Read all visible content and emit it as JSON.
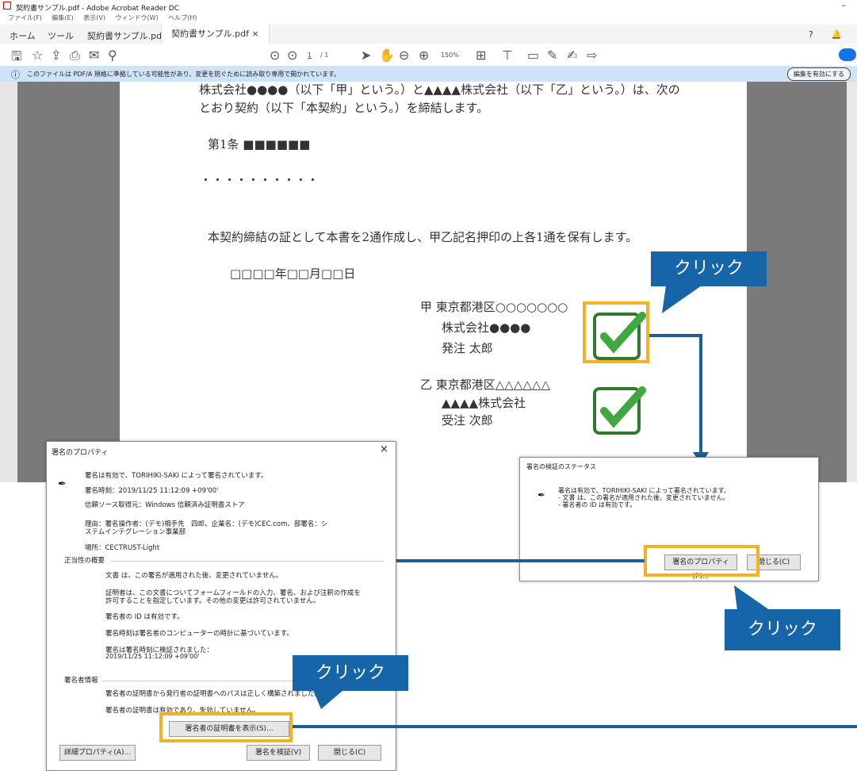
{
  "window": {
    "title": "契約書サンプル.pdf - Adobe Acrobat Reader DC",
    "menu": [
      "ファイル(F)",
      "編集(E)",
      "表示(V)",
      "ウィンドウ(W)",
      "ヘルプ(H)"
    ],
    "tabs": [
      "ホーム",
      "ツール",
      "契約書サンプル.pdf",
      "契約書サンプル.pdf ×"
    ],
    "page_current": "1",
    "page_total": "/ 1",
    "zoom": "150%",
    "info_text": "このファイルは PDF/A 規格に準拠している可能性があり、変更を防ぐために読み取り専用で開かれています。",
    "enable_edit": "編集を有効にする"
  },
  "document": {
    "line1": "株式会社●●●●（以下「甲」という。）と▲▲▲▲株式会社（以下「乙」という。）は、次の",
    "line2": "とおり契約（以下「本契約」という。）を締結します。",
    "article": "第1条 ■■■■■■",
    "dots": "・・・・・・・・・・",
    "closing": "本契約締結の証として本書を2通作成し、甲乙記名押印の上各1通を保有します。",
    "date": "□□□□年□□月□□日",
    "party_a": [
      "甲 東京都港区○○○○○○○",
      "株式会社●●●●",
      "発注 太郎"
    ],
    "party_b": [
      "乙 東京都港区△△△△△△",
      "▲▲▲▲株式会社",
      "受注 次郎"
    ]
  },
  "callouts": {
    "click": "クリック"
  },
  "status_dialog": {
    "title": "署名の検証のステータス",
    "lines": [
      "署名は有効で、TORIHIKI-SAKI によって署名されています。",
      "- 文書 は、この署名が適用された後、変更されていません。",
      "- 署名者の ID は有効です。"
    ],
    "properties_button": "署名のプロパティ(P)...",
    "close_button": "閉じる(C)"
  },
  "properties_dialog": {
    "title": "署名のプロパティ",
    "close_x": "×",
    "signed_by": "署名は有効で、TORIHIKI-SAKI によって署名されています。",
    "signed_time": "署名時刻：2019/11/25 11:12:09 +09'00'",
    "trust_source": "信頼ソース取得元：Windows 信頼済み証明書ストア",
    "reason1": "理由：署名操作者：(デモ)相手先　四郎、企業名：(デモ)CEC.com、部署名：シ",
    "reason2": "ステムインテグレーション事業部",
    "location": "場所：CECTRUST-Light",
    "validity_header": "正当性の概要",
    "validity": [
      "文書 は、この署名が適用された後、変更されていません。",
      "証明者は、この文書についてフォームフィールドの入力、署名、および注釈の作成を",
      "許可することを指定しています。その他の変更は許可されていません。",
      "署名者の ID は有効です。",
      "署名時刻は署名者のコンピューターの時計に基づいています。",
      "署名は署名時刻に検証されました：",
      "2019/11/25 11:12:09 +09'00'"
    ],
    "signer_header": "署名者情報",
    "signer": [
      "署名者の証明書から発行者の証明書へのパスは正しく構築されました。",
      "署名者の証明書は有効であり、失効していません。"
    ],
    "show_cert_button": "署名者の証明書を表示(S)...",
    "advanced_button": "詳細プロパティ(A)...",
    "verify_button": "署名を検証(V)",
    "close_button": "閉じる(C)"
  }
}
